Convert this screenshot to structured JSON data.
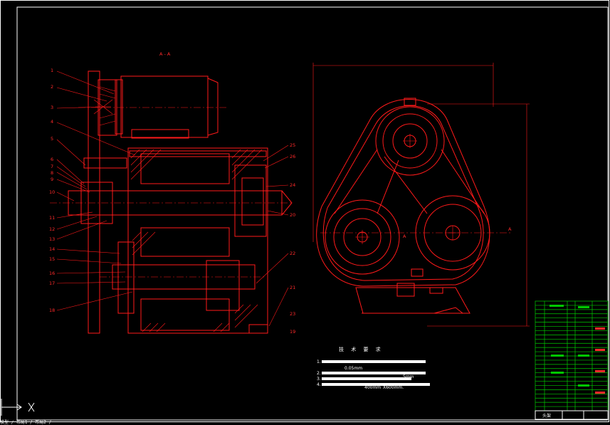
{
  "drawing": {
    "section_label": "A - A",
    "tech_title": "技 术 要 求",
    "tech_notes": [
      "1.",
      "2.",
      "3.",
      "4."
    ],
    "tech_values": [
      "0.05mm",
      "0.05mm",
      "5mm",
      "400mm",
      "X600mm."
    ],
    "title_block_name": "头架",
    "view_labels": [
      "A",
      "A"
    ]
  },
  "callouts_left": [
    "1",
    "2",
    "3",
    "4",
    "5",
    "6",
    "7",
    "8",
    "9",
    "10",
    "11",
    "12",
    "13",
    "14",
    "15",
    "16",
    "17",
    "18"
  ],
  "callouts_right": [
    "25",
    "26",
    "24",
    "20",
    "22",
    "21",
    "23",
    "19"
  ],
  "bom_rows": 26,
  "colors": {
    "background": "#000000",
    "lines": "#ff1a1a",
    "frame": "#ffffff",
    "table": "#00c800"
  },
  "command_line": "模型 / 布局1 / 布局2 /"
}
